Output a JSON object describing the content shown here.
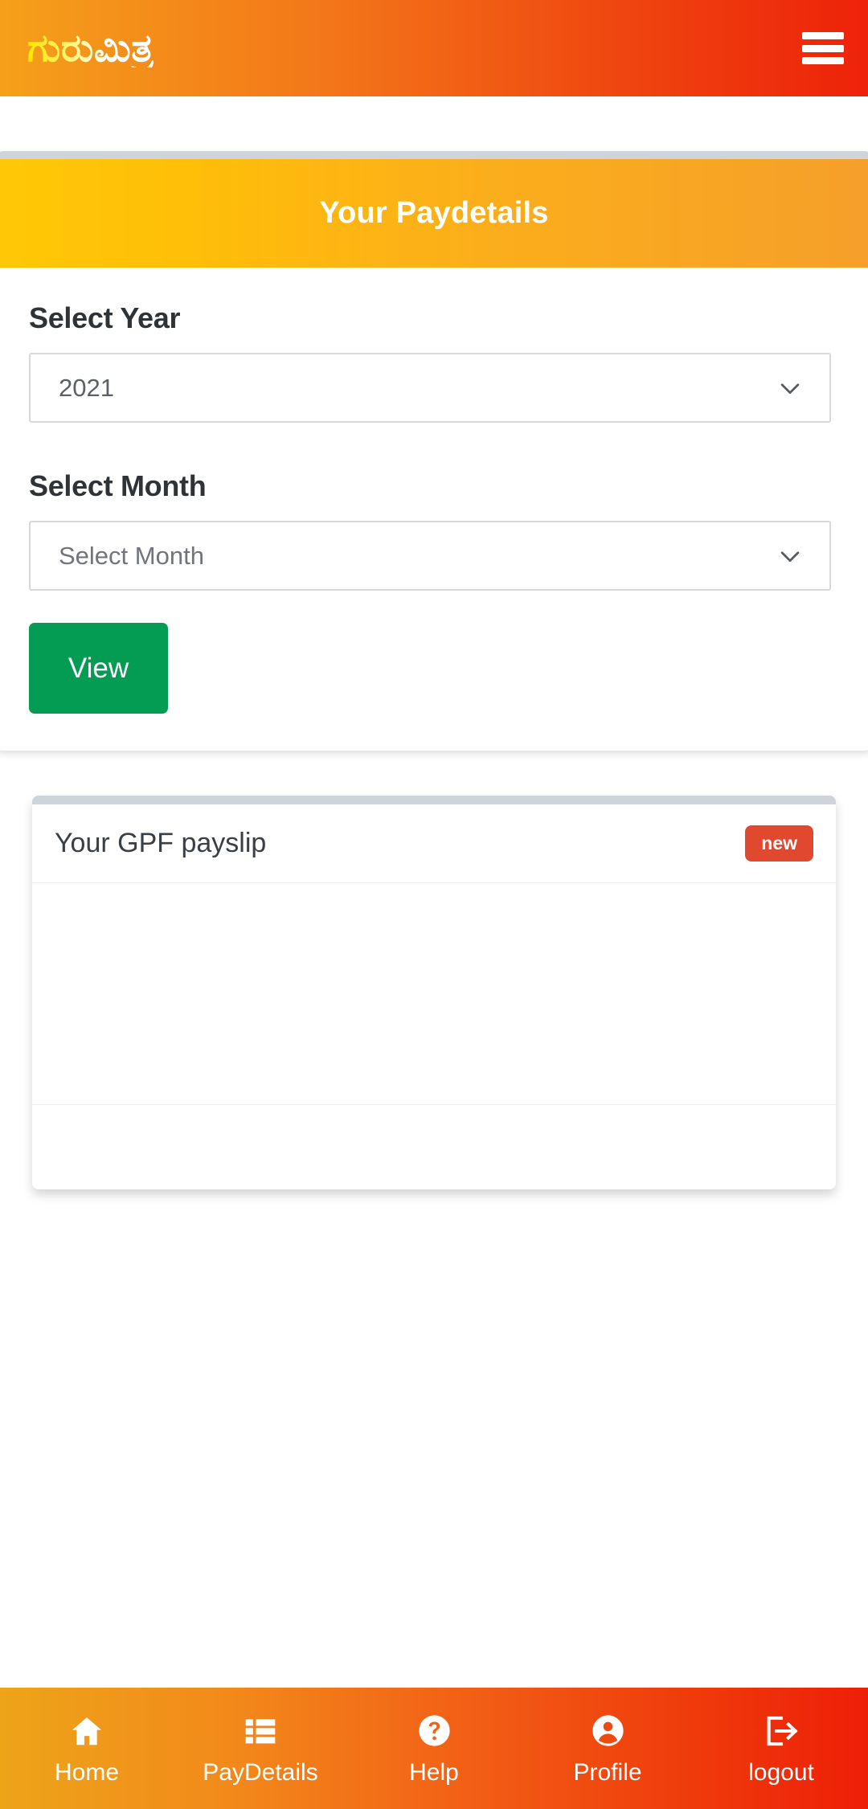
{
  "header": {
    "brand": "ಗುರುಮಿತ್ರ",
    "menu_icon": "hamburger-menu-icon",
    "gradient_from": "#f5a01a",
    "gradient_to": "#ed2209"
  },
  "pay_card": {
    "title": "Your Paydetails",
    "header_gradient_from": "#ffc806",
    "header_gradient_to": "#f59f2a",
    "year": {
      "label": "Select Year",
      "value": "2021",
      "chevron_icon": "chevron-down-icon"
    },
    "month": {
      "label": "Select Month",
      "value": "Select Month",
      "chevron_icon": "chevron-down-icon"
    },
    "view_button": {
      "label": "View",
      "color": "#049b52"
    }
  },
  "gpf_card": {
    "title": "Your GPF payslip",
    "badge": "new",
    "badge_color": "#e0482f"
  },
  "bottom_nav": {
    "items": [
      {
        "label": "Home",
        "icon": "home-icon"
      },
      {
        "label": "PayDetails",
        "icon": "list-icon"
      },
      {
        "label": "Help",
        "icon": "question-circle-icon"
      },
      {
        "label": "Profile",
        "icon": "user-circle-icon"
      },
      {
        "label": "logout",
        "icon": "logout-icon"
      }
    ],
    "gradient_from": "#eda419",
    "gradient_to": "#ee1f07"
  }
}
